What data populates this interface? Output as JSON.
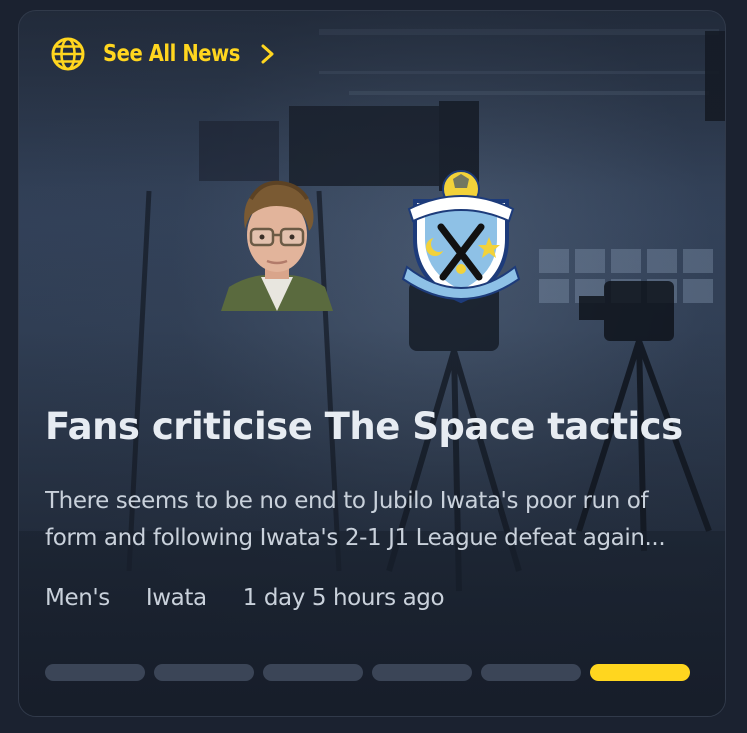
{
  "header": {
    "link_label": "See All News",
    "icon": "globe-icon",
    "chevron": "chevron-right-icon"
  },
  "article": {
    "title": "Fans criticise The Space tactics",
    "summary_line1": "There seems to be no end to Jubilo Iwata's poor run of",
    "summary_line2": "form and following Iwata's 2-1 J1 League defeat again...",
    "tags": [
      "Men's",
      "Iwata"
    ],
    "time_ago": "1 day 5 hours ago"
  },
  "pagination": {
    "total": 6,
    "active_index": 5
  },
  "colors": {
    "accent": "#ffd61f",
    "background": "#1b2230",
    "title": "#e7ecf2",
    "body_text": "#c9d1db",
    "inactive_dot": "#3b4557"
  }
}
